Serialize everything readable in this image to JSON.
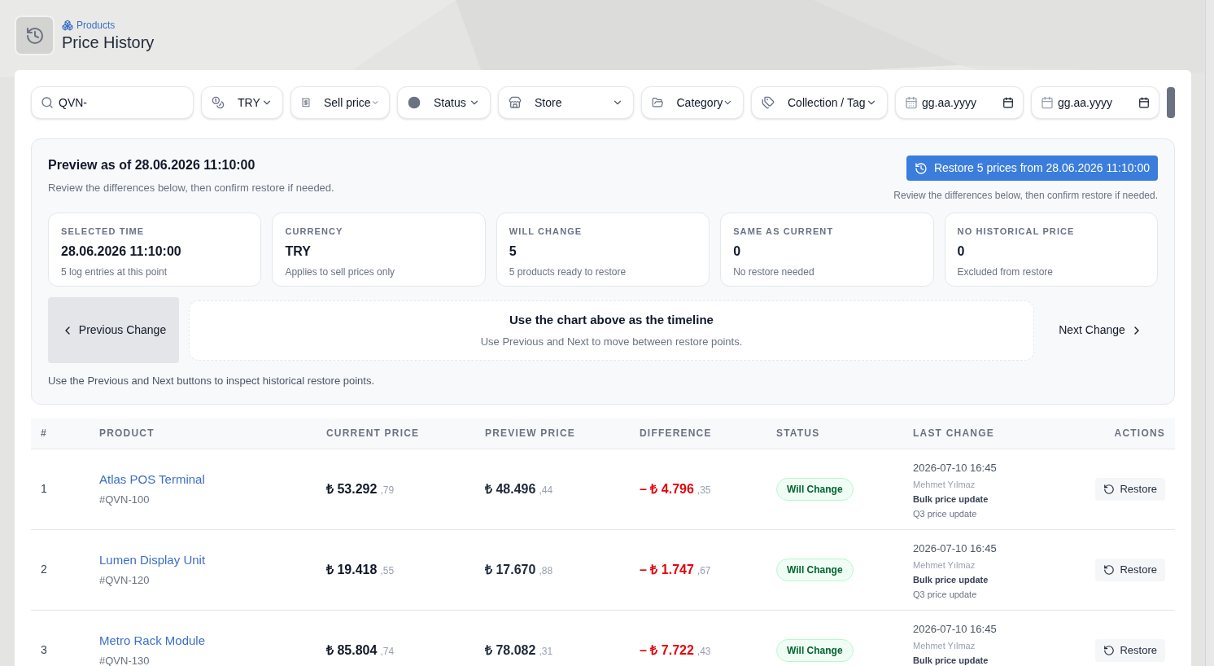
{
  "breadcrumb": "Products",
  "title": "Price History",
  "filters": [
    {
      "kind": "search",
      "value": "QVN-"
    },
    {
      "kind": "select",
      "label": "TRY"
    },
    {
      "kind": "select",
      "label": "Sell price"
    },
    {
      "kind": "select",
      "label": "Status"
    },
    {
      "kind": "select",
      "label": "Store"
    },
    {
      "kind": "select",
      "label": "Category"
    },
    {
      "kind": "select",
      "label": "Collection / Tag"
    },
    {
      "kind": "date",
      "placeholder": "gg.aa.yyyy"
    },
    {
      "kind": "date",
      "placeholder": "gg.aa.yyyy"
    }
  ],
  "preview": {
    "title": "Preview as of 28.06.2026 11:10:00",
    "subtitle": "Review the differences below, then confirm restore if needed.",
    "restore_button": "Restore 5 prices from 28.06.2026 11:10:00",
    "restore_hint": "Review the differences below, then confirm restore if needed.",
    "stats": [
      {
        "label": "SELECTED TIME",
        "value": "28.06.2026 11:10:00",
        "note": "5 log entries at this point"
      },
      {
        "label": "CURRENCY",
        "value": "TRY",
        "note": "Applies to sell prices only"
      },
      {
        "label": "WILL CHANGE",
        "value": "5",
        "note": "5 products ready to restore"
      },
      {
        "label": "SAME AS CURRENT",
        "value": "0",
        "note": "No restore needed"
      },
      {
        "label": "NO HISTORICAL PRICE",
        "value": "0",
        "note": "Excluded from restore"
      }
    ],
    "previous_button": "Previous Change",
    "timeline_title": "Use the chart above as the timeline",
    "timeline_text": "Use Previous and Next to move between restore points.",
    "next_button": "Next Change",
    "footer_note": "Use the Previous and Next buttons to inspect historical restore points."
  },
  "table": {
    "columns": [
      "#",
      "PRODUCT",
      "CURRENT PRICE",
      "PREVIEW PRICE",
      "DIFFERENCE",
      "STATUS",
      "LAST CHANGE",
      "ACTIONS"
    ],
    "rows": [
      {
        "index": "1",
        "product": "Atlas POS Terminal",
        "sku": "#QVN-100",
        "current": {
          "main": "₺ 53.292",
          "cents": ",79"
        },
        "preview": {
          "main": "₺ 48.496",
          "cents": ",44"
        },
        "difference": {
          "main": "– ₺ 4.796",
          "cents": ",35"
        },
        "status": "Will Change",
        "date": "2026-07-10 16:45",
        "user": "Mehmet Yılmaz",
        "change": "Bulk price update",
        "note": "Q3 price update",
        "action": "Restore"
      },
      {
        "index": "2",
        "product": "Lumen Display Unit",
        "sku": "#QVN-120",
        "current": {
          "main": "₺ 19.418",
          "cents": ",55"
        },
        "preview": {
          "main": "₺ 17.670",
          "cents": ",88"
        },
        "difference": {
          "main": "– ₺ 1.747",
          "cents": ",67"
        },
        "status": "Will Change",
        "date": "2026-07-10 16:45",
        "user": "Mehmet Yılmaz",
        "change": "Bulk price update",
        "note": "Q3 price update",
        "action": "Restore"
      },
      {
        "index": "3",
        "product": "Metro Rack Module",
        "sku": "#QVN-130",
        "current": {
          "main": "₺ 85.804",
          "cents": ",74"
        },
        "preview": {
          "main": "₺ 78.082",
          "cents": ",31"
        },
        "difference": {
          "main": "– ₺ 7.722",
          "cents": ",43"
        },
        "status": "Will Change",
        "date": "2026-07-10 16:45",
        "user": "Mehmet Yılmaz",
        "change": "Bulk price update",
        "action": "Restore"
      }
    ]
  }
}
